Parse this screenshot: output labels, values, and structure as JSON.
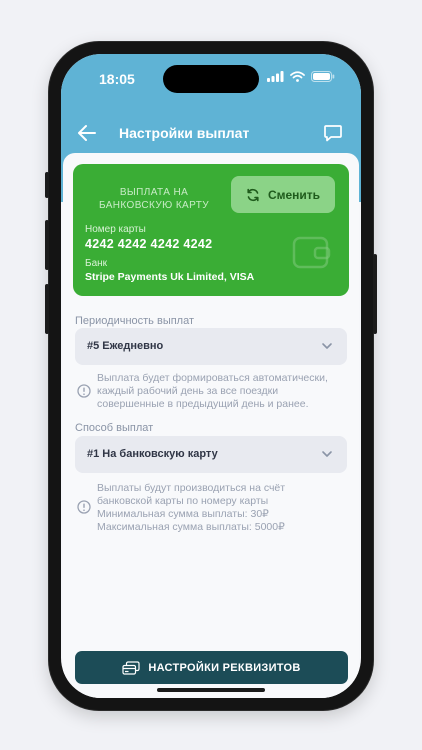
{
  "status": {
    "time": "18:05"
  },
  "nav": {
    "title": "Настройки выплат"
  },
  "card": {
    "caption": "ВЫПЛАТА НА БАНКОВСКУЮ КАРТУ",
    "change_label": "Сменить",
    "number_label": "Номер карты",
    "number_value": "4242 4242 4242 4242",
    "bank_label": "Банк",
    "bank_value": "Stripe Payments Uk Limited, VISA"
  },
  "frequency": {
    "label": "Периодичность выплат",
    "value": "#5 Ежедневно",
    "hint": "Выплата будет формироваться автоматически,\nкаждый рабочий день за все поездки\nсовершенные в предыдущий день и ранее."
  },
  "method": {
    "label": "Способ выплат",
    "value": "#1 На банковскую карту",
    "hint": "Выплаты будут производиться на счёт\nбанковской карты по номеру карты\nМинимальная сумма выплаты: 30₽\nМаксимальная сумма выплаты: 5000₽"
  },
  "bottom_button": {
    "label": "НАСТРОЙКИ РЕКВИЗИТОВ"
  },
  "colors": {
    "accent": "#5fb3d5",
    "card": "#3aad35",
    "button": "#1c4c57"
  }
}
